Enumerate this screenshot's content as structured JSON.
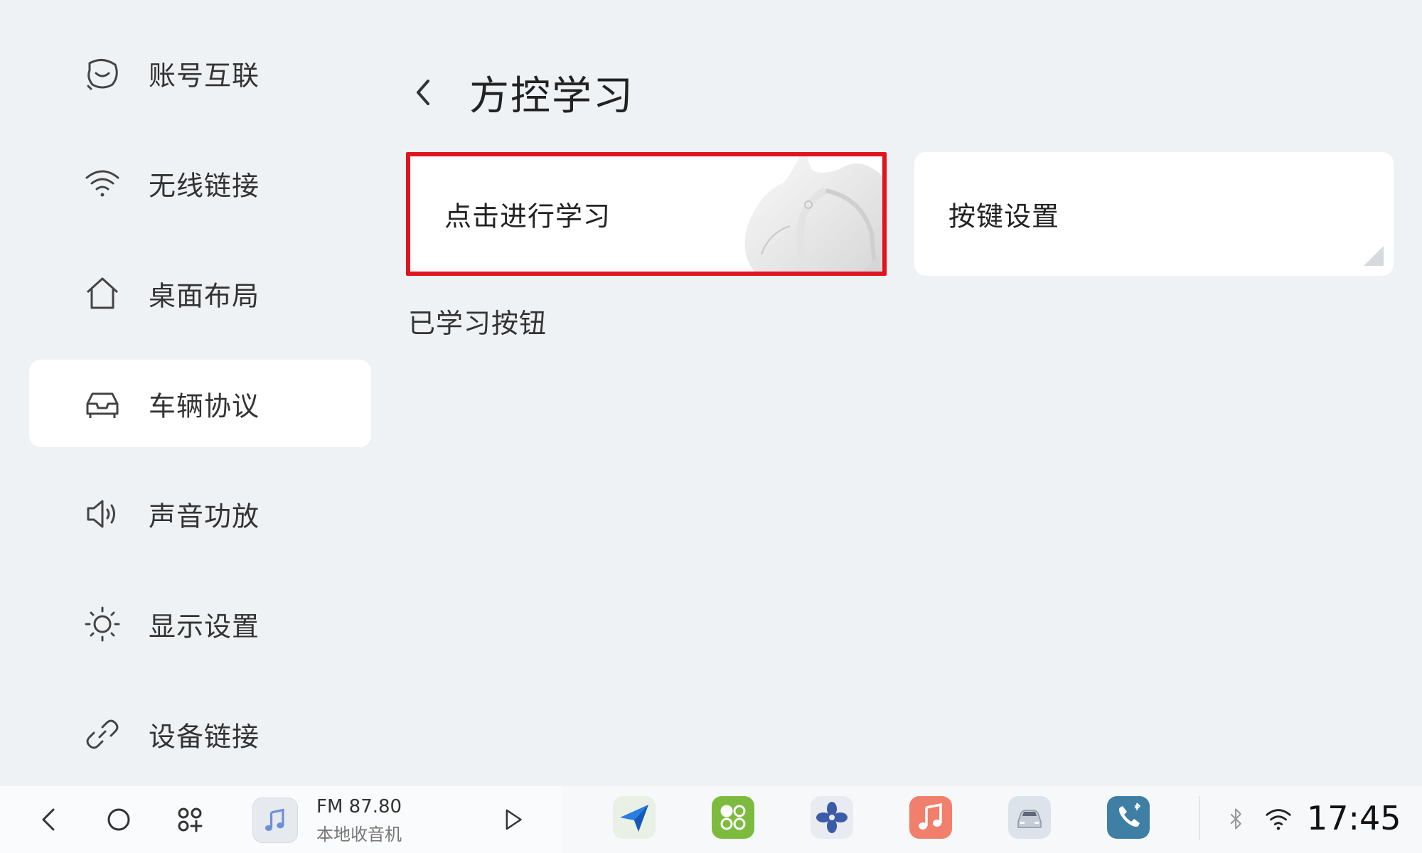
{
  "sidebar": {
    "items": [
      {
        "label": "账号互联",
        "icon": "account-link-icon"
      },
      {
        "label": "无线链接",
        "icon": "wifi-icon"
      },
      {
        "label": "桌面布局",
        "icon": "home-icon"
      },
      {
        "label": "车辆协议",
        "icon": "car-icon",
        "active": true
      },
      {
        "label": "声音功放",
        "icon": "speaker-icon"
      },
      {
        "label": "显示设置",
        "icon": "brightness-icon"
      },
      {
        "label": "设备链接",
        "icon": "link-icon"
      }
    ]
  },
  "main": {
    "title": "方控学习",
    "cards": {
      "learn_label": "点击进行学习",
      "keys_label": "按键设置"
    },
    "section_title": "已学习按钮"
  },
  "taskbar": {
    "radio_freq": "FM 87.80",
    "radio_source": "本地收音机",
    "clock": "17:45",
    "apps": [
      "navigation-app-icon",
      "apps-launcher-icon",
      "fan-climate-icon",
      "music-app-icon",
      "vehicle-app-icon",
      "bluetooth-phone-icon"
    ]
  },
  "colors": {
    "background": "#eff2f5",
    "highlight_border": "#e0141f",
    "card": "#ffffff"
  }
}
